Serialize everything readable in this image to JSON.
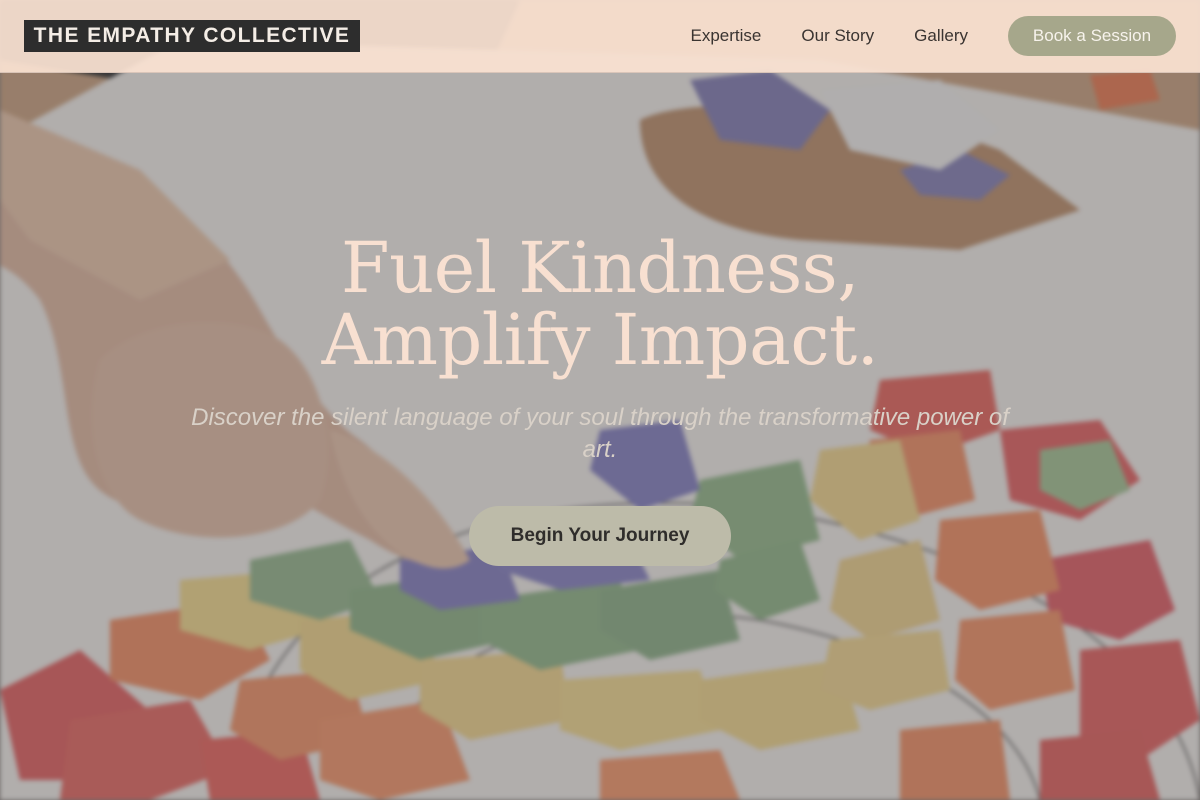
{
  "header": {
    "brand": "THE EMPATHY COLLECTIVE",
    "nav": [
      {
        "label": "Expertise"
      },
      {
        "label": "Our Story"
      },
      {
        "label": "Gallery"
      }
    ],
    "cta_label": "Book a Session"
  },
  "hero": {
    "title_line1": "Fuel Kindness,",
    "title_line2": "Amplify Impact.",
    "subtitle": "Discover the silent language of your soul through the transformative power of art.",
    "cta_label": "Begin Your Journey",
    "background_image": "child-making-paper-rainbow-collage"
  },
  "colors": {
    "header_bg": "#fae2d2",
    "brand_bg": "#2d2d2d",
    "accent_button": "#a6a78b",
    "hero_title": "#f8e0d1",
    "cta_button": "#bdbba9"
  }
}
